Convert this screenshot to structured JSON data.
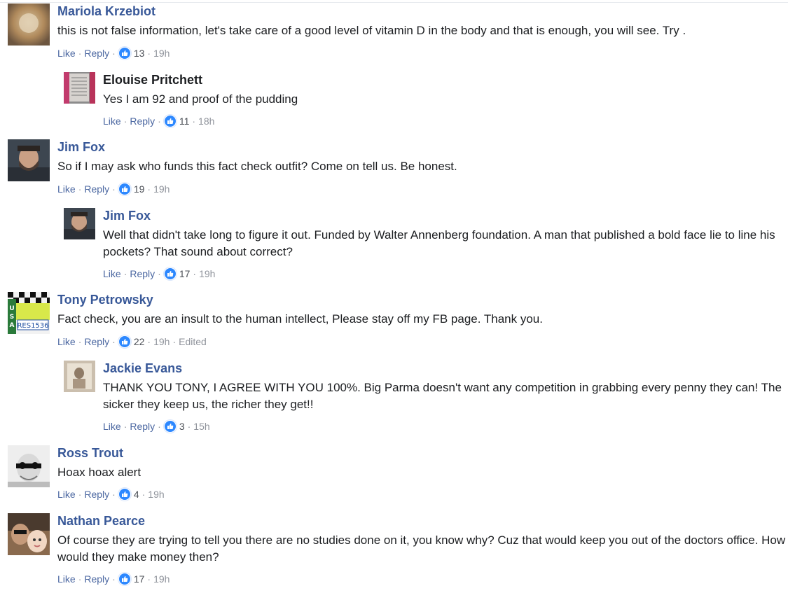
{
  "colors": {
    "name": "#385898",
    "link": "#4b67a1",
    "muted": "#90949c",
    "like_badge": "#2d88ff"
  },
  "meta_labels": {
    "like": "Like",
    "reply": "Reply",
    "dot": "·"
  },
  "comments": [
    {
      "name": "Mariola Krzebiot",
      "text": "this is not false information, let's take care of a good level of vitamin D in the body and that is enough, you will see. Try .",
      "likes": "13",
      "time": "19h"
    },
    {
      "name": "Elouise Pritchett",
      "text": "Yes I am 92 and proof of the pudding",
      "likes": "11",
      "time": "18h"
    },
    {
      "name": "Jim Fox",
      "text": "So if I may ask who funds this fact check outfit? Come on tell us. Be honest.",
      "likes": "19",
      "time": "19h"
    },
    {
      "name": "Jim Fox",
      "text": "Well that didn't take long to figure it out. Funded by Walter Annenberg foundation. A man that published a bold face lie to line his pockets? That sound about correct?",
      "likes": "17",
      "time": "19h"
    },
    {
      "name": "Tony Petrowsky",
      "text": "Fact check, you are an insult to the human intellect, Please stay off my FB page. Thank you.",
      "likes": "22",
      "time": "19h",
      "edited": "Edited",
      "avatar_text": [
        "USA",
        "RES1536"
      ]
    },
    {
      "name": "Jackie Evans",
      "text": "THANK YOU TONY, I AGREE WITH YOU 100%. Big Parma doesn't want any competition in grabbing every penny they can! The sicker they keep us, the richer they get!!",
      "likes": "3",
      "time": "15h"
    },
    {
      "name": "Ross Trout",
      "text": "Hoax hoax alert",
      "likes": "4",
      "time": "19h"
    },
    {
      "name": "Nathan Pearce",
      "text": "Of course they are trying to tell you there are no studies done on it, you know why? Cuz that would keep you out of the doctors office. How would they make money then?",
      "likes": "17",
      "time": "19h"
    }
  ]
}
